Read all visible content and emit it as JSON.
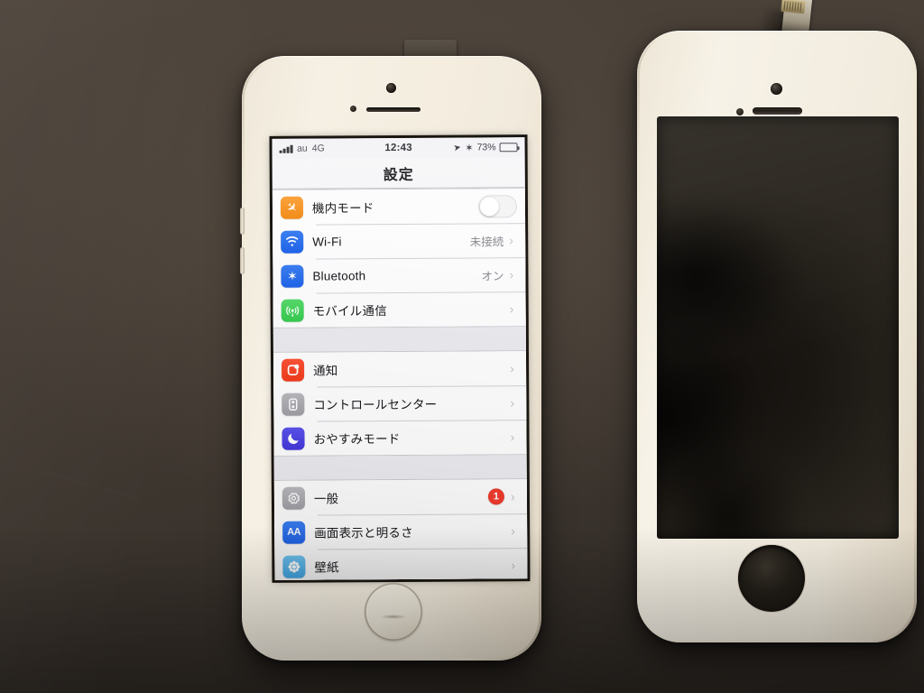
{
  "scene": {
    "description": "Two iPhone 5s devices on a dark desk: left powered on showing Japanese Settings, right a detached white replacement screen assembly",
    "background_color": "#443c34"
  },
  "left_device": {
    "name": "iphone-5s-gold",
    "body_color": "#f3ecdd",
    "home_button": "touch-id-home-button"
  },
  "right_device": {
    "name": "replacement-screen-assembly-white",
    "body_color": "#f1ebde",
    "glass_color": "#1a1713",
    "home_button_hole": "empty"
  },
  "screen": {
    "status_bar": {
      "signal_icon": "signal-bars-icon",
      "carrier": "au",
      "network": "4G",
      "time": "12:43",
      "location_icon": "location-arrow-icon",
      "bluetooth_icon": "bluetooth-icon",
      "battery_percent": "73%",
      "battery_icon": "battery-full-icon"
    },
    "nav": {
      "title": "設定"
    },
    "groups": [
      {
        "rows": [
          {
            "icon": "airplane-icon",
            "icon_class": "ico-plane",
            "glyph": "✈",
            "label": "機内モード",
            "value": "",
            "accessory": "switch",
            "switch_on": false,
            "badge": ""
          },
          {
            "icon": "wifi-icon",
            "icon_class": "ico-wifi",
            "glyph": "",
            "label": "Wi-Fi",
            "value": "未接続",
            "accessory": "chevron",
            "switch_on": false,
            "badge": ""
          },
          {
            "icon": "bluetooth-icon",
            "icon_class": "ico-bt",
            "glyph": "",
            "label": "Bluetooth",
            "value": "オン",
            "accessory": "chevron",
            "switch_on": false,
            "badge": ""
          },
          {
            "icon": "cellular-icon",
            "icon_class": "ico-cell",
            "glyph": "",
            "label": "モバイル通信",
            "value": "",
            "accessory": "chevron",
            "switch_on": false,
            "badge": ""
          }
        ]
      },
      {
        "rows": [
          {
            "icon": "notifications-icon",
            "icon_class": "ico-notif",
            "glyph": "",
            "label": "通知",
            "value": "",
            "accessory": "chevron",
            "switch_on": false,
            "badge": ""
          },
          {
            "icon": "control-center-icon",
            "icon_class": "ico-cc",
            "glyph": "",
            "label": "コントロールセンター",
            "value": "",
            "accessory": "chevron",
            "switch_on": false,
            "badge": ""
          },
          {
            "icon": "do-not-disturb-icon",
            "icon_class": "ico-dnd",
            "glyph": "",
            "label": "おやすみモード",
            "value": "",
            "accessory": "chevron",
            "switch_on": false,
            "badge": ""
          }
        ]
      },
      {
        "rows": [
          {
            "icon": "gear-icon",
            "icon_class": "ico-general",
            "glyph": "",
            "label": "一般",
            "value": "",
            "accessory": "chevron",
            "switch_on": false,
            "badge": "1"
          },
          {
            "icon": "display-icon",
            "icon_class": "ico-display",
            "glyph": "AA",
            "label": "画面表示と明るさ",
            "value": "",
            "accessory": "chevron",
            "switch_on": false,
            "badge": ""
          },
          {
            "icon": "wallpaper-icon",
            "icon_class": "ico-wall",
            "glyph": "",
            "label": "壁紙",
            "value": "",
            "accessory": "chevron",
            "switch_on": false,
            "badge": ""
          }
        ]
      }
    ]
  },
  "colors": {
    "badge_red": "#ef3b2d",
    "ios_blue": "#1f63e8",
    "list_bg": "#efeff4",
    "row_bg": "#fcfcfd"
  }
}
